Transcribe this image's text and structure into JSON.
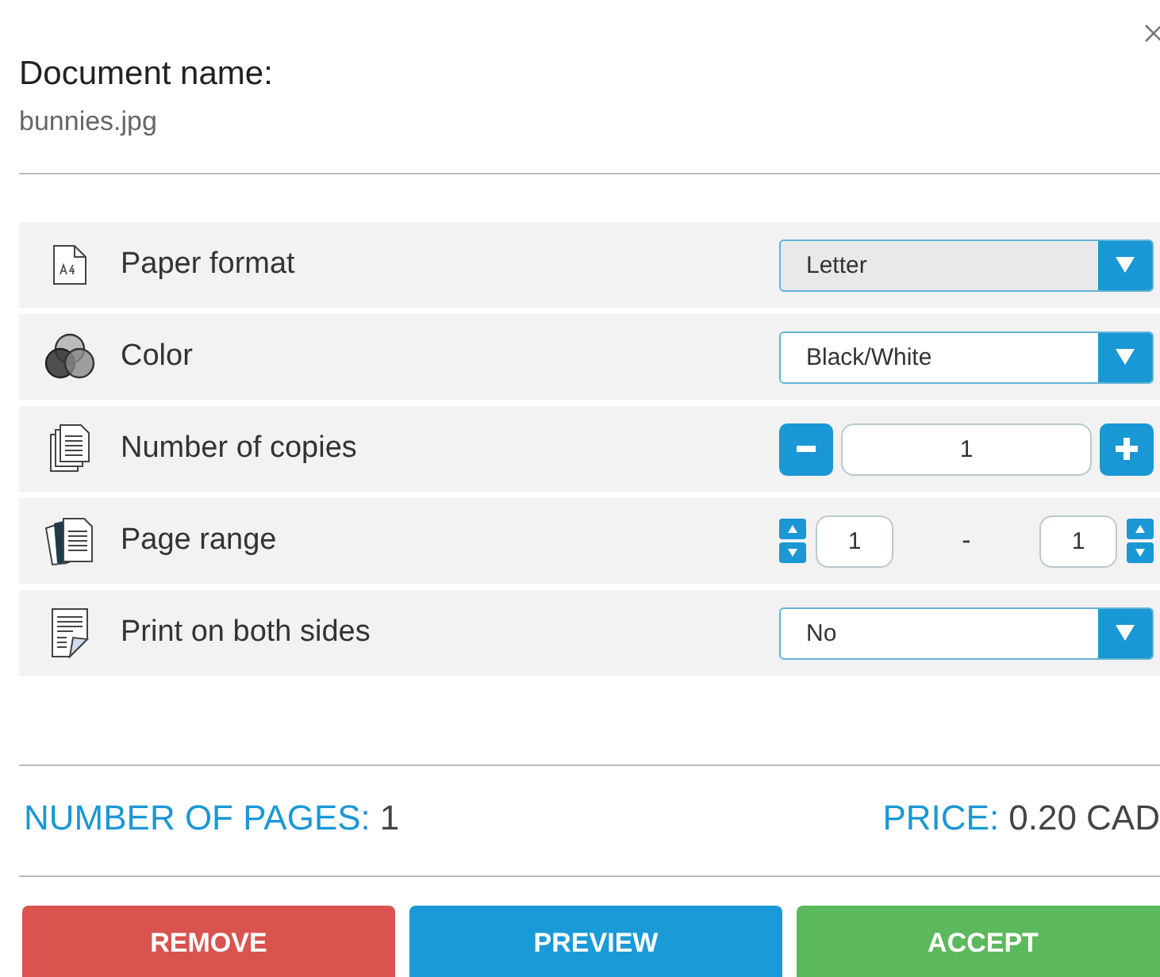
{
  "document": {
    "label": "Document name:",
    "value": "bunnies.jpg"
  },
  "options": [
    {
      "kind": "select",
      "label": "Paper format",
      "value": "Letter",
      "focused": true
    },
    {
      "kind": "select",
      "label": "Color",
      "value": "Black/White",
      "focused": false
    },
    {
      "kind": "stepper",
      "label": "Number of copies",
      "value": "1"
    },
    {
      "kind": "range",
      "label": "Page range",
      "from": "1",
      "separator": "-",
      "to": "1"
    },
    {
      "kind": "select",
      "label": "Print on both sides",
      "value": "No",
      "focused": false
    }
  ],
  "summary": {
    "pages_label": "NUMBER OF PAGES:",
    "pages": "1",
    "price_label": "PRICE:",
    "price": "0.20 CAD"
  },
  "buttons": [
    {
      "kind": "remove",
      "label": "REMOVE"
    },
    {
      "kind": "preview",
      "label": "PREVIEW"
    },
    {
      "kind": "accept",
      "label": "ACCEPT"
    }
  ]
}
